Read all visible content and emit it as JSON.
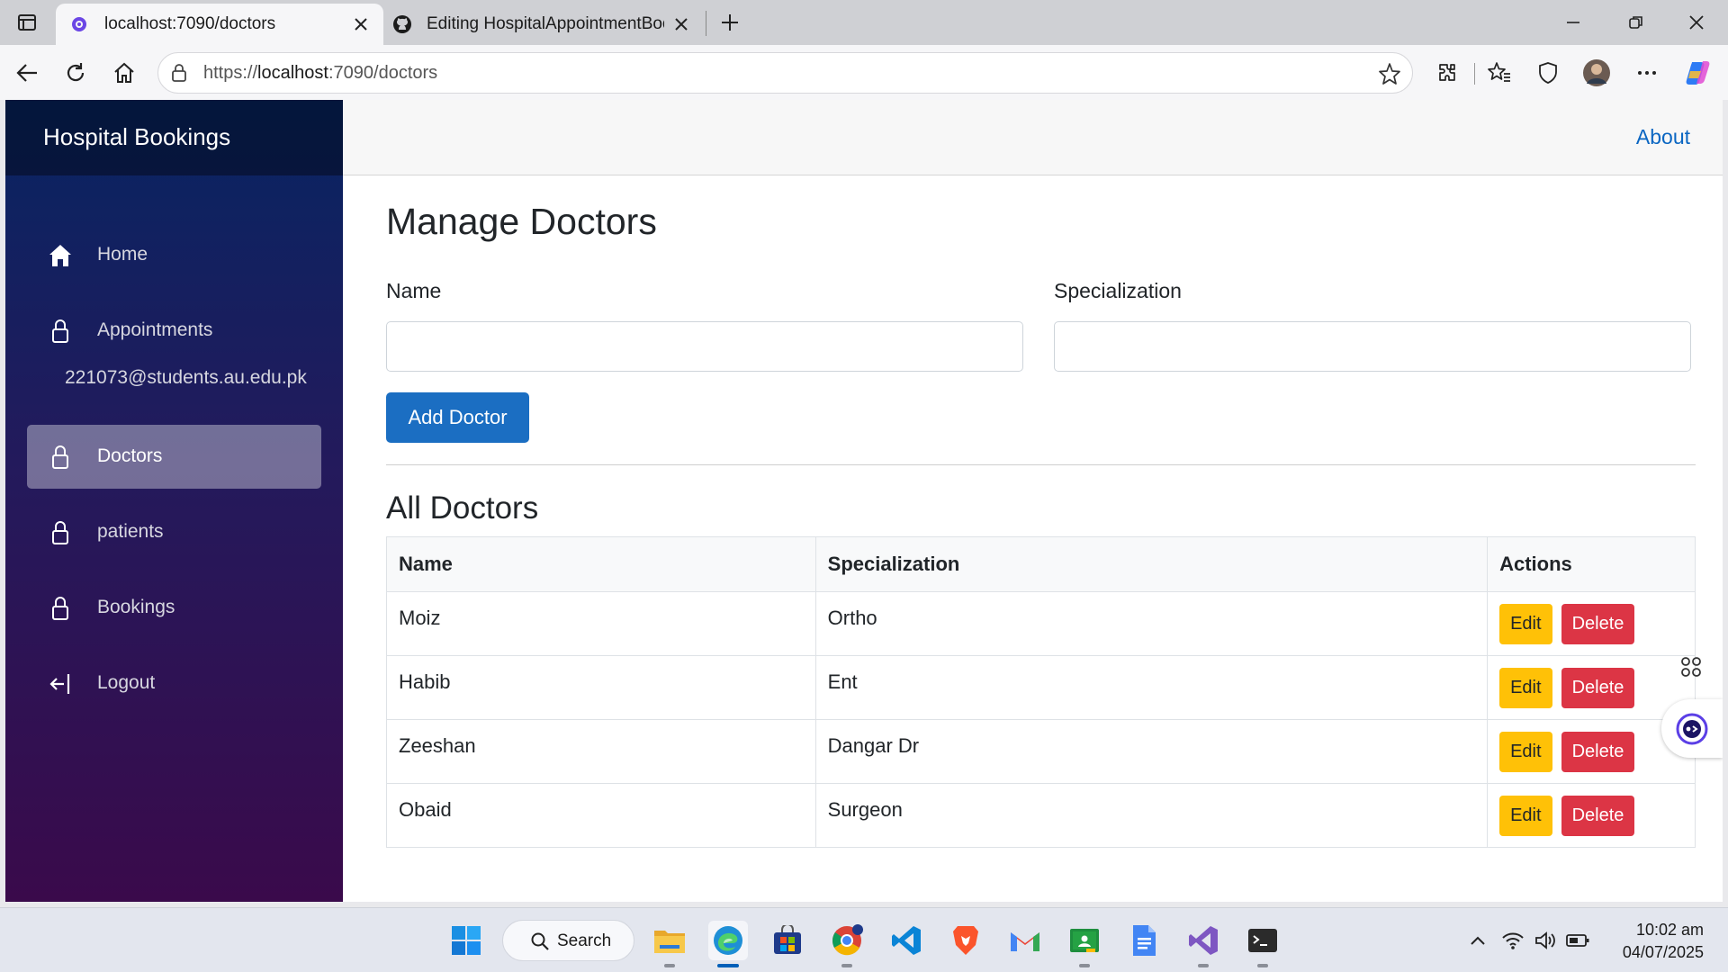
{
  "browser": {
    "tabs": [
      {
        "title": "localhost:7090/doctors",
        "active": true
      },
      {
        "title": "Editing HospitalAppointmentBooking",
        "active": false
      }
    ],
    "address": {
      "prefix": "https://",
      "host": "localhost",
      "path": ":7090/doctors"
    }
  },
  "app": {
    "brand": "Hospital Bookings",
    "about_link": "About",
    "sidebar": {
      "items": [
        {
          "label": "Home",
          "icon": "house-icon"
        },
        {
          "label": "Appointments",
          "icon": "lock-icon"
        },
        {
          "label": "Doctors",
          "icon": "lock-icon",
          "active": true
        },
        {
          "label": "patients",
          "icon": "lock-icon"
        },
        {
          "label": "Bookings",
          "icon": "lock-icon"
        },
        {
          "label": "Logout",
          "icon": "logout-icon"
        }
      ],
      "user_email": "221073@students.au.edu.pk"
    },
    "main": {
      "title": "Manage Doctors",
      "form": {
        "name_label": "Name",
        "name_value": "",
        "specialization_label": "Specialization",
        "specialization_value": "",
        "add_button": "Add Doctor"
      },
      "list_title": "All Doctors",
      "table": {
        "headers": [
          "Name",
          "Specialization",
          "Actions"
        ],
        "rows": [
          {
            "name": "Moiz",
            "specialization": "Ortho"
          },
          {
            "name": "Habib",
            "specialization": "Ent"
          },
          {
            "name": "Zeeshan",
            "specialization": "Dangar Dr"
          },
          {
            "name": "Obaid",
            "specialization": "Surgeon"
          }
        ],
        "edit_label": "Edit",
        "delete_label": "Delete"
      }
    }
  },
  "taskbar": {
    "search_label": "Search",
    "time": "10:02 am",
    "date": "04/07/2025"
  },
  "colors": {
    "primary": "#1b6ec2",
    "edit": "#ffc107",
    "delete": "#dc3545",
    "sidebar_top": "#072562",
    "sidebar_bottom": "#3a0a4b"
  }
}
